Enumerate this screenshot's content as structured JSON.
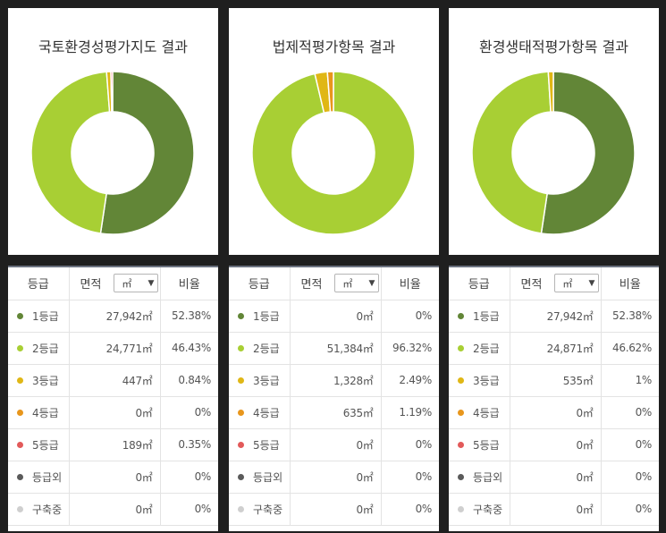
{
  "colors": {
    "grade1": "#628637",
    "grade2": "#a8cf34",
    "grade3": "#e0b715",
    "grade4": "#e8961c",
    "grade5": "#e25a5a",
    "outside": "#5a5a5a",
    "building": "#cfcfcf"
  },
  "header": {
    "grade": "등급",
    "area": "면적",
    "unit": "㎡",
    "ratio": "비율"
  },
  "panels": [
    {
      "title": "국토환경성평가지도 결과",
      "rows": [
        {
          "grade": "1등급",
          "area": "27,942㎡",
          "ratio": "52.38%",
          "pct": 52.38
        },
        {
          "grade": "2등급",
          "area": "24,771㎡",
          "ratio": "46.43%",
          "pct": 46.43
        },
        {
          "grade": "3등급",
          "area": "447㎡",
          "ratio": "0.84%",
          "pct": 0.84
        },
        {
          "grade": "4등급",
          "area": "0㎡",
          "ratio": "0%",
          "pct": 0
        },
        {
          "grade": "5등급",
          "area": "189㎡",
          "ratio": "0.35%",
          "pct": 0.35
        },
        {
          "grade": "등급외",
          "area": "0㎡",
          "ratio": "0%",
          "pct": 0
        },
        {
          "grade": "구축중",
          "area": "0㎡",
          "ratio": "0%",
          "pct": 0
        }
      ]
    },
    {
      "title": "법제적평가항목 결과",
      "rows": [
        {
          "grade": "1등급",
          "area": "0㎡",
          "ratio": "0%",
          "pct": 0
        },
        {
          "grade": "2등급",
          "area": "51,384㎡",
          "ratio": "96.32%",
          "pct": 96.32
        },
        {
          "grade": "3등급",
          "area": "1,328㎡",
          "ratio": "2.49%",
          "pct": 2.49
        },
        {
          "grade": "4등급",
          "area": "635㎡",
          "ratio": "1.19%",
          "pct": 1.19
        },
        {
          "grade": "5등급",
          "area": "0㎡",
          "ratio": "0%",
          "pct": 0
        },
        {
          "grade": "등급외",
          "area": "0㎡",
          "ratio": "0%",
          "pct": 0
        },
        {
          "grade": "구축중",
          "area": "0㎡",
          "ratio": "0%",
          "pct": 0
        }
      ]
    },
    {
      "title": "환경생태적평가항목 결과",
      "rows": [
        {
          "grade": "1등급",
          "area": "27,942㎡",
          "ratio": "52.38%",
          "pct": 52.38
        },
        {
          "grade": "2등급",
          "area": "24,871㎡",
          "ratio": "46.62%",
          "pct": 46.62
        },
        {
          "grade": "3등급",
          "area": "535㎡",
          "ratio": "1%",
          "pct": 1
        },
        {
          "grade": "4등급",
          "area": "0㎡",
          "ratio": "0%",
          "pct": 0
        },
        {
          "grade": "5등급",
          "area": "0㎡",
          "ratio": "0%",
          "pct": 0
        },
        {
          "grade": "등급외",
          "area": "0㎡",
          "ratio": "0%",
          "pct": 0
        },
        {
          "grade": "구축중",
          "area": "0㎡",
          "ratio": "0%",
          "pct": 0
        }
      ]
    }
  ]
}
